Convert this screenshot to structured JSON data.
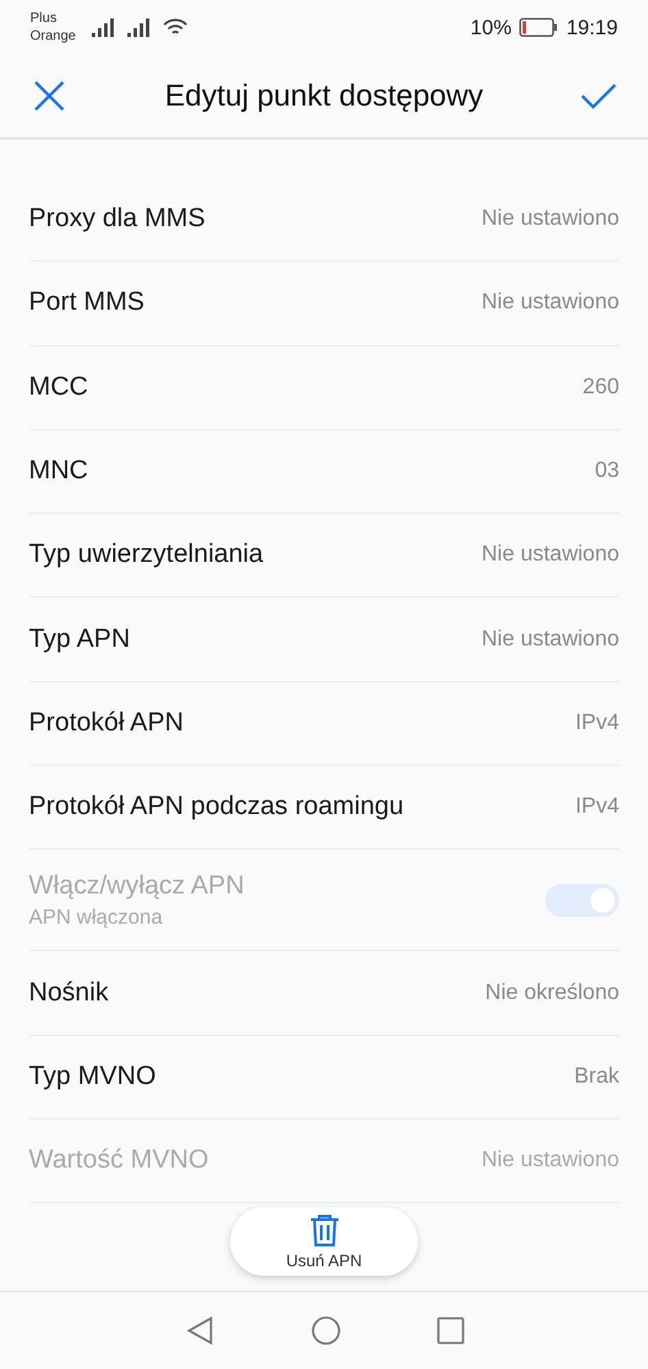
{
  "status_bar": {
    "carrier_line_1": "Plus",
    "carrier_line_2": "Orange",
    "battery_percent": "10%",
    "time": "19:19"
  },
  "header": {
    "title": "Edytuj punkt dostępowy"
  },
  "settings": [
    {
      "kind": "value",
      "label": "Proxy dla MMS",
      "value": "Nie ustawiono",
      "disabled": false
    },
    {
      "kind": "value",
      "label": "Port MMS",
      "value": "Nie ustawiono",
      "disabled": false
    },
    {
      "kind": "value",
      "label": "MCC",
      "value": "260",
      "disabled": false
    },
    {
      "kind": "value",
      "label": "MNC",
      "value": "03",
      "disabled": false
    },
    {
      "kind": "value",
      "label": "Typ uwierzytelniania",
      "value": "Nie ustawiono",
      "disabled": false
    },
    {
      "kind": "value",
      "label": "Typ APN",
      "value": "Nie ustawiono",
      "disabled": false
    },
    {
      "kind": "value",
      "label": "Protokół APN",
      "value": "IPv4",
      "disabled": false
    },
    {
      "kind": "value",
      "label": "Protokół APN podczas roamingu",
      "value": "IPv4",
      "disabled": false
    },
    {
      "kind": "toggle",
      "label": "Włącz/wyłącz APN",
      "summary": "APN włączona",
      "on": true,
      "disabled": true
    },
    {
      "kind": "value",
      "label": "Nośnik",
      "value": "Nie określono",
      "disabled": false
    },
    {
      "kind": "value",
      "label": "Typ MVNO",
      "value": "Brak",
      "disabled": false
    },
    {
      "kind": "value",
      "label": "Wartość MVNO",
      "value": "Nie ustawiono",
      "disabled": true
    }
  ],
  "delete_button": {
    "label": "Usuń APN"
  }
}
